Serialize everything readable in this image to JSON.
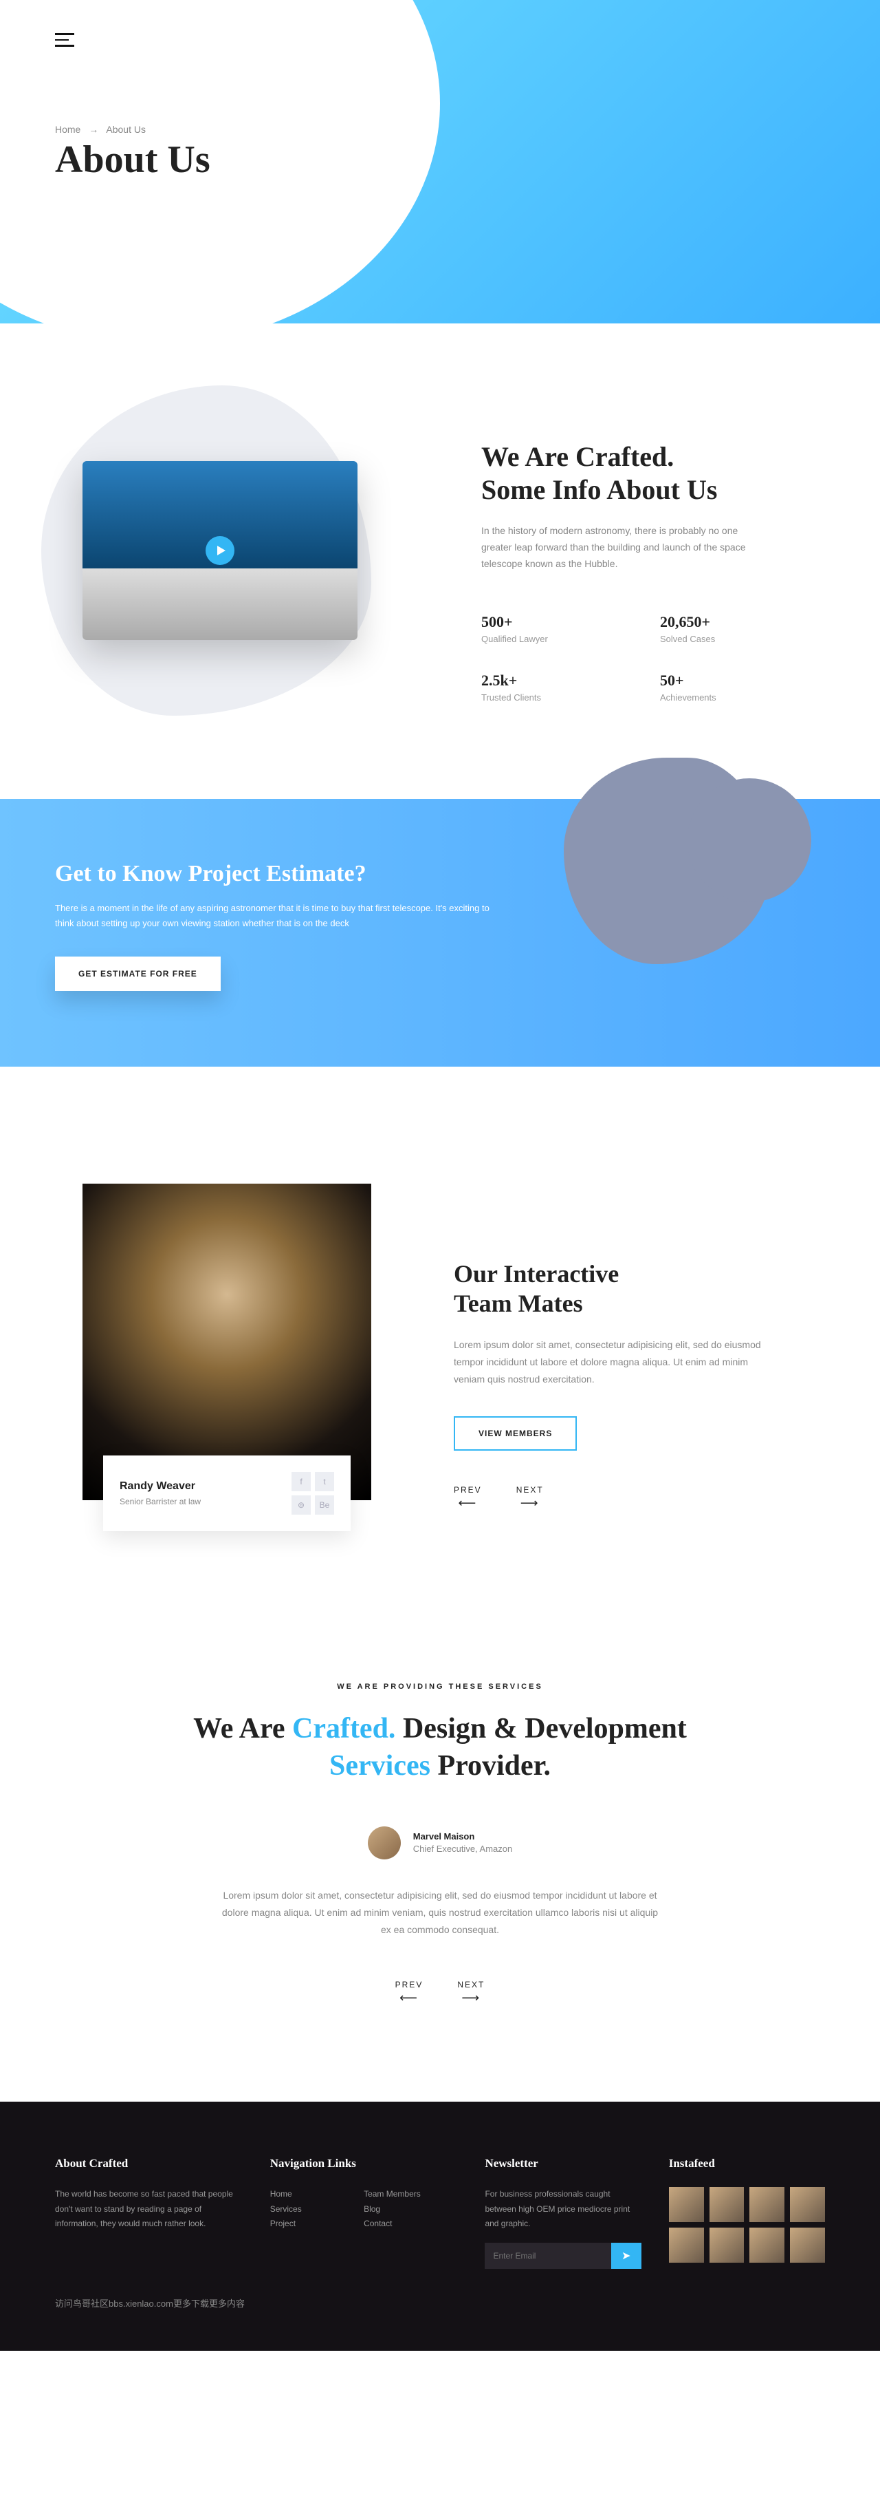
{
  "hero": {
    "breadcrumb_home": "Home",
    "breadcrumb_sep": "→",
    "breadcrumb_current": "About Us",
    "title": "About Us"
  },
  "crafted": {
    "heading_l1": "We Are Crafted.",
    "heading_l2": "Some Info About Us",
    "desc": "In the history of modern astronomy, there is probably no one greater leap forward than the building and launch of the space telescope known as the Hubble.",
    "stats": [
      {
        "num": "500+",
        "label": "Qualified Lawyer"
      },
      {
        "num": "20,650+",
        "label": "Solved Cases"
      },
      {
        "num": "2.5k+",
        "label": "Trusted Clients"
      },
      {
        "num": "50+",
        "label": "Achievements"
      }
    ]
  },
  "cta": {
    "heading": "Get to Know Project Estimate?",
    "desc": "There is a moment in the life of any aspiring astronomer that it is time to buy that first telescope. It's exciting to think about setting up your own viewing station whether that is on the deck",
    "button": "GET ESTIMATE FOR FREE"
  },
  "team": {
    "member_name": "Randy Weaver",
    "member_role": "Senior Barrister at law",
    "heading_l1": "Our Interactive",
    "heading_l2": "Team Mates",
    "desc": "Lorem ipsum dolor sit amet, consectetur adipisicing elit, sed do eiusmod tempor incididunt ut labore et dolore magna aliqua. Ut enim ad minim veniam quis nostrud exercitation.",
    "button": "VIEW MEMBERS",
    "prev": "PREV",
    "next": "NEXT"
  },
  "services": {
    "eyebrow": "WE ARE PROVIDING THESE SERVICES",
    "h_p1": "We Are ",
    "h_blue1": "Crafted.",
    "h_p2": " Design & Development",
    "h_blue2": "Services",
    "h_p3": " Provider.",
    "avatar_name": "Marvel Maison",
    "avatar_title": "Chief Executive, Amazon",
    "desc": "Lorem ipsum dolor sit amet, consectetur adipisicing elit, sed do eiusmod tempor incididunt ut labore et dolore magna aliqua. Ut enim ad minim veniam, quis nostrud exercitation ullamco laboris nisi ut aliquip ex ea commodo consequat.",
    "prev": "PREV",
    "next": "NEXT"
  },
  "footer": {
    "about_h": "About Crafted",
    "about_p": "The world has become so fast paced that people don't want to stand by reading a page of information, they would much rather look.",
    "nav_h": "Navigation Links",
    "nav_links": [
      "Home",
      "Services",
      "Project",
      "Team Members",
      "Blog",
      "Contact"
    ],
    "news_h": "Newsletter",
    "news_p": "For business professionals caught between high OEM price mediocre print and graphic.",
    "email_placeholder": "Enter Email",
    "insta_h": "Instafeed",
    "watermark": "访问鸟哥社区bbs.xienlao.com更多下载更多内容"
  }
}
